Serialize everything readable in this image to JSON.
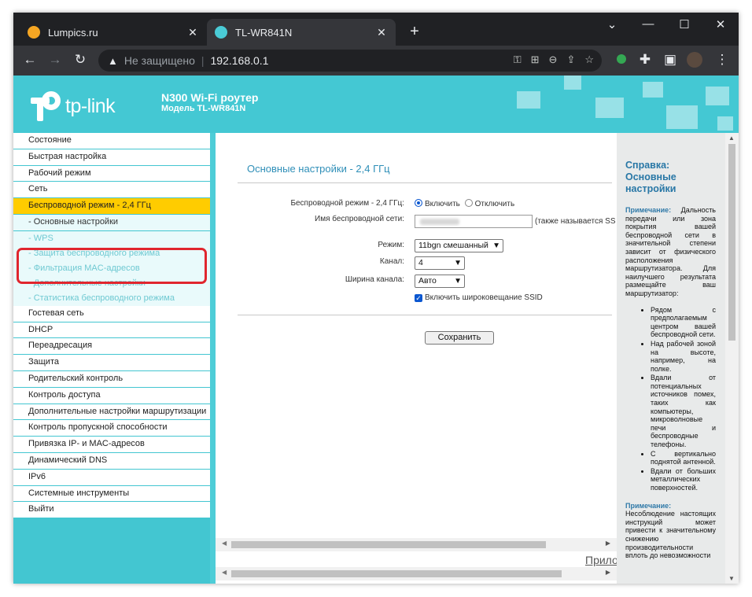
{
  "browser": {
    "tabs": [
      {
        "title": "Lumpics.ru",
        "active": false
      },
      {
        "title": "TL-WR841N",
        "active": true
      }
    ],
    "new_tab": "+",
    "address": {
      "security_label": "Не защищено",
      "url": "192.168.0.1"
    }
  },
  "router": {
    "logo_text": "tp-link",
    "model_name": "N300 Wi-Fi роутер",
    "model_number": "Модель TL-WR841N"
  },
  "menu": [
    {
      "label": "Состояние",
      "type": "item"
    },
    {
      "label": "Быстрая настройка",
      "type": "item"
    },
    {
      "label": "Рабочий режим",
      "type": "item"
    },
    {
      "label": "Сеть",
      "type": "item"
    },
    {
      "label": "Беспроводной режим - 2,4 ГГц",
      "type": "active"
    },
    {
      "label": "- Основные настройки",
      "type": "sub"
    },
    {
      "label": "- WPS",
      "type": "sub2"
    },
    {
      "label": "- Защита беспроводного режима",
      "type": "sub2"
    },
    {
      "label": "- Фильтрация MAC-адресов",
      "type": "sub2"
    },
    {
      "label": "- Дополнительные настройки",
      "type": "sub2"
    },
    {
      "label": "- Статистика беспроводного режима",
      "type": "sub2"
    },
    {
      "label": "Гостевая сеть",
      "type": "item"
    },
    {
      "label": "DHCP",
      "type": "item"
    },
    {
      "label": "Переадресация",
      "type": "item"
    },
    {
      "label": "Защита",
      "type": "item"
    },
    {
      "label": "Родительский контроль",
      "type": "item"
    },
    {
      "label": "Контроль доступа",
      "type": "item"
    },
    {
      "label": "Дополнительные настройки маршрутизации",
      "type": "item"
    },
    {
      "label": "Контроль пропускной способности",
      "type": "item"
    },
    {
      "label": "Привязка IP- и MAC-адресов",
      "type": "item"
    },
    {
      "label": "Динамический DNS",
      "type": "item"
    },
    {
      "label": "IPv6",
      "type": "item"
    },
    {
      "label": "Системные инструменты",
      "type": "item"
    },
    {
      "label": "Выйти",
      "type": "item"
    }
  ],
  "form": {
    "title": "Основные настройки - 2,4 ГГц",
    "wireless_label": "Беспроводной режим - 2,4 ГГц:",
    "enable_label": "Включить",
    "disable_label": "Отключить",
    "ssid_label": "Имя беспроводной сети:",
    "ssid_note": "(также называется SS",
    "mode_label": "Режим:",
    "mode_value": "11bgn смешанный",
    "channel_label": "Канал:",
    "channel_value": "4",
    "width_label": "Ширина канала:",
    "width_value": "Авто",
    "broadcast_label": "Включить широковещание SSID",
    "save_label": "Сохранить",
    "bottom_link": "Прило"
  },
  "help": {
    "title": "Справка: Основные настройки",
    "note1_label": "Примечание:",
    "note1_text": "Дальность передачи или зона покрытия вашей беспроводной сети в значительной степени зависит от физического расположения маршрутизатора. Для наилучшего результата размещайте ваш маршрутизатор:",
    "items": [
      "Рядом с предполагаемым центром вашей беспроводной сети.",
      "Над рабочей зоной на высоте, например, на полке.",
      "Вдали от потенциальных источников помех, таких как компьютеры, микроволновые печи и беспроводные телефоны.",
      "С вертикально поднятой антенной.",
      "Вдали от больших металлических поверхностей."
    ],
    "note2_label": "Примечание:",
    "note2_text": "Несоблюдение настоящих инструкций может привести к значительному снижению производительности вплоть до невозможности"
  }
}
